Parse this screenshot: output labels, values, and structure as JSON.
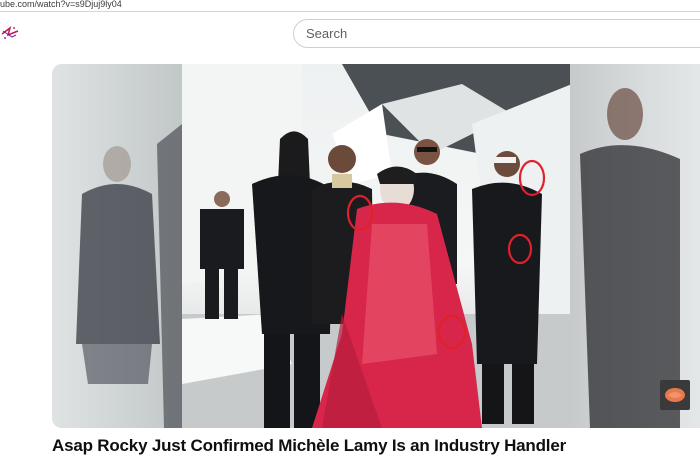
{
  "browser": {
    "url": "ube.com/watch?v=s9Djuj9ly04"
  },
  "header": {
    "search_placeholder": "Search"
  },
  "video": {
    "title": "Asap Rocky Just Confirmed Michèle Lamy Is an Industry Handler",
    "annotation_color": "#e0202a"
  }
}
